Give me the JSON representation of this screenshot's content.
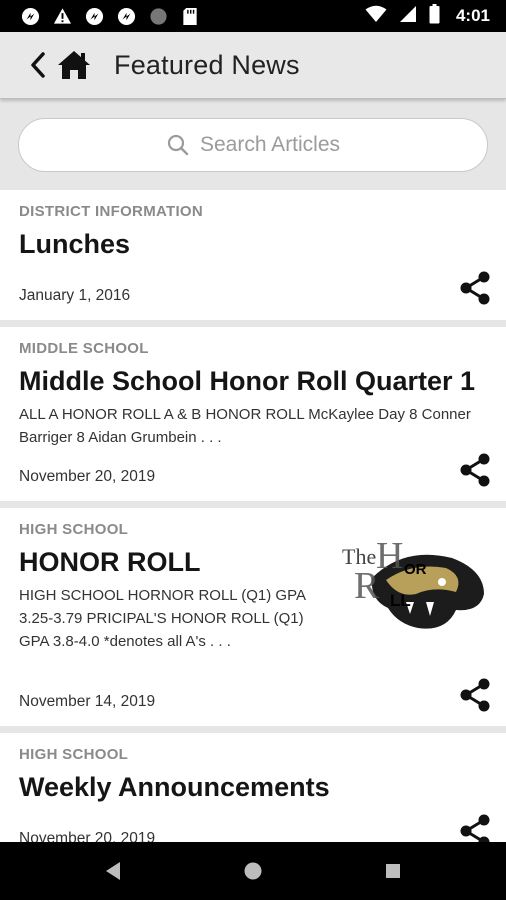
{
  "status_bar": {
    "time": "4:01",
    "left_icons": [
      "sync-icon",
      "warning-icon",
      "sync-icon",
      "sync-icon",
      "record-icon",
      "sd-card-icon"
    ],
    "right_icons": [
      "wifi-icon",
      "signal-icon",
      "battery-icon"
    ]
  },
  "app_bar": {
    "title": "Featured News",
    "back_icon": "chevron-left-icon",
    "home_icon": "home-icon"
  },
  "search": {
    "placeholder": "Search Articles",
    "icon": "search-icon"
  },
  "articles": [
    {
      "category": "DISTRICT INFORMATION",
      "title": "Lunches",
      "snippet": "",
      "date": "January 1, 2016",
      "has_image": false
    },
    {
      "category": "MIDDLE SCHOOL",
      "title": "Middle School Honor Roll Quarter 1",
      "snippet": "ALL A HONOR ROLL   A & B HONOR ROLL McKaylee Day 8 Conner Barriger 8 Aidan Grumbein . . .",
      "date": "November 20, 2019",
      "has_image": false
    },
    {
      "category": "HIGH SCHOOL",
      "title": "HONOR ROLL",
      "snippet": "HIGH SCHOOL HORNOR ROLL (Q1) GPA 3.25-3.79   PRICIPAL'S HONOR ROLL  (Q1) GPA 3.8-4.0 *denotes all A's . . .",
      "date": "November 14, 2019",
      "has_image": true,
      "image_text": "The Honor Roll"
    },
    {
      "category": "HIGH SCHOOL",
      "title": "Weekly Announcements",
      "snippet": "",
      "date": "November 20, 2019",
      "has_image": false
    }
  ],
  "nav_bar": {
    "buttons": [
      "back-triangle-icon",
      "home-circle-icon",
      "recents-square-icon"
    ]
  },
  "colors": {
    "status_bar_bg": "#000000",
    "app_bar_bg": "#e8e8e8",
    "feed_bg": "#e6e6e6",
    "card_bg": "#ffffff",
    "category_text": "#8a8a8a"
  }
}
